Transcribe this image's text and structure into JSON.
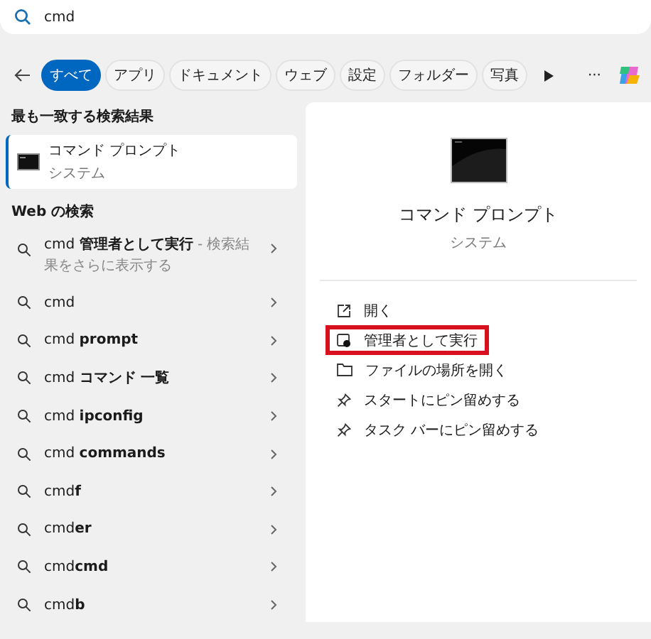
{
  "search": {
    "value": "cmd"
  },
  "tabs": [
    {
      "label": "すべて",
      "selected": true
    },
    {
      "label": "アプリ",
      "selected": false
    },
    {
      "label": "ドキュメント",
      "selected": false
    },
    {
      "label": "ウェブ",
      "selected": false
    },
    {
      "label": "設定",
      "selected": false
    },
    {
      "label": "フォルダー",
      "selected": false
    },
    {
      "label": "写真",
      "selected": false
    }
  ],
  "more": "···",
  "best_match": {
    "heading": "最も一致する検索結果",
    "title": "コマンド プロンプト",
    "subtitle": "システム",
    "selected": true
  },
  "web": {
    "heading": "Web の検索",
    "items": [
      {
        "text": "cmd **管理者として実行**",
        "hint": " - 検索結果をさらに表示する"
      },
      {
        "text": "cmd"
      },
      {
        "text": "cmd **prompt**"
      },
      {
        "text": "cmd **コマンド 一覧**"
      },
      {
        "text": "cmd **ipconfig**"
      },
      {
        "text": "cmd **commands**"
      },
      {
        "text": "cmd**f**"
      },
      {
        "text": "cmd**er**"
      },
      {
        "text": "cmd**cmd**"
      },
      {
        "text": "cmd**b**"
      }
    ]
  },
  "detail": {
    "title": "コマンド プロンプト",
    "subtitle": "システム",
    "actions": [
      {
        "kind": "open",
        "label": "開く",
        "highlighted": false
      },
      {
        "kind": "admin",
        "label": "管理者として実行",
        "highlighted": true
      },
      {
        "kind": "folder",
        "label": "ファイルの場所を開く",
        "highlighted": false
      },
      {
        "kind": "pin",
        "label": "スタートにピン留めする",
        "highlighted": false
      },
      {
        "kind": "pin",
        "label": "タスク バーにピン留めする",
        "highlighted": false
      }
    ]
  }
}
